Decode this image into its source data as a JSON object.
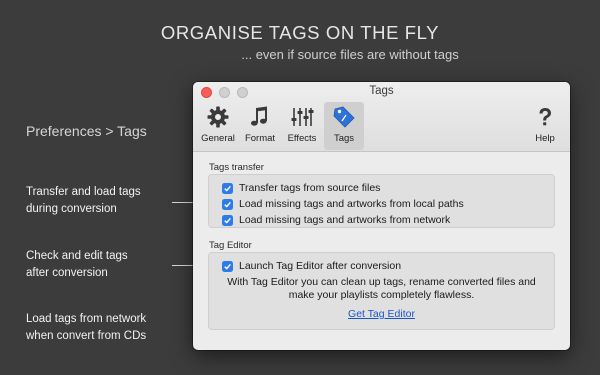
{
  "hero": {
    "title": "ORGANISE TAGS ON THE FLY",
    "subtitle": "... even if source files are without tags"
  },
  "side_labels": {
    "preferences": "Preferences > Tags",
    "transfer": [
      "Transfer and load tags",
      "during conversion"
    ],
    "check": [
      "Check and edit tags",
      "after conversion"
    ],
    "network": [
      "Load tags from network",
      "when convert from CDs"
    ]
  },
  "window": {
    "title": "Tags",
    "toolbar": [
      {
        "label": "General",
        "icon": "gear-icon"
      },
      {
        "label": "Format",
        "icon": "music-note-icon"
      },
      {
        "label": "Effects",
        "icon": "sliders-icon"
      },
      {
        "label": "Tags",
        "icon": "tag-icon",
        "active": true
      },
      {
        "label": "Help",
        "icon": "question-icon"
      }
    ],
    "tags_transfer": {
      "heading": "Tags transfer",
      "options": [
        {
          "label": "Transfer tags from source files",
          "checked": true
        },
        {
          "label": "Load missing tags and artworks from local paths",
          "checked": true
        },
        {
          "label": "Load missing tags and artworks from network",
          "checked": true
        }
      ]
    },
    "tag_editor": {
      "heading": "Tag Editor",
      "option": {
        "label": "Launch Tag Editor after conversion",
        "checked": true
      },
      "description_lines": [
        "With Tag Editor you can clean up tags, rename converted files and",
        "make your playlists completely flawless."
      ],
      "link": "Get Tag Editor"
    }
  },
  "colors": {
    "background": "#3c3c3c",
    "checkbox": "#2f7ce9",
    "link": "#1a56c8",
    "tag_icon": "#2f72d6"
  }
}
